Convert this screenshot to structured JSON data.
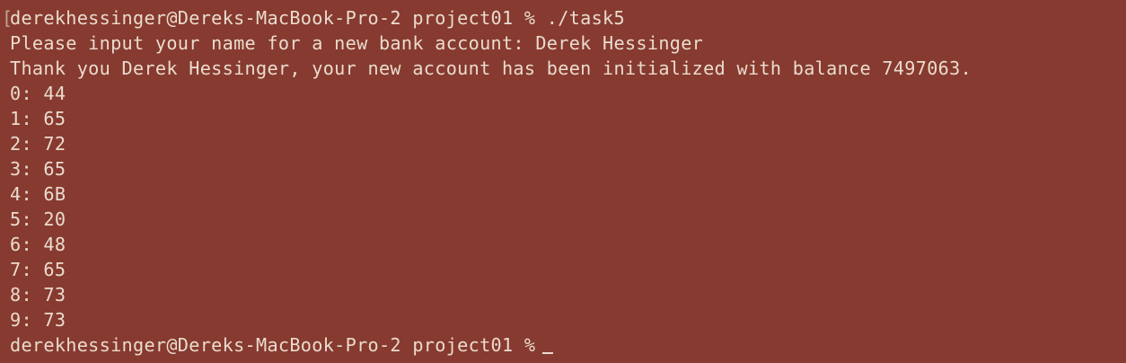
{
  "terminal": {
    "marker": "[",
    "lines": [
      "derekhessinger@Dereks-MacBook-Pro-2 project01 % ./task5",
      "Please input your name for a new bank account: Derek Hessinger",
      "Thank you Derek Hessinger, your new account has been initialized with balance 7497063.",
      "0: 44",
      "1: 65",
      "2: 72",
      "3: 65",
      "4: 6B",
      "5: 20",
      "6: 48",
      "7: 65",
      "8: 73",
      "9: 73"
    ],
    "prompt": "derekhessinger@Dereks-MacBook-Pro-2 project01 %"
  },
  "colors": {
    "background": "#873a2f",
    "text": "#eadbcf"
  }
}
